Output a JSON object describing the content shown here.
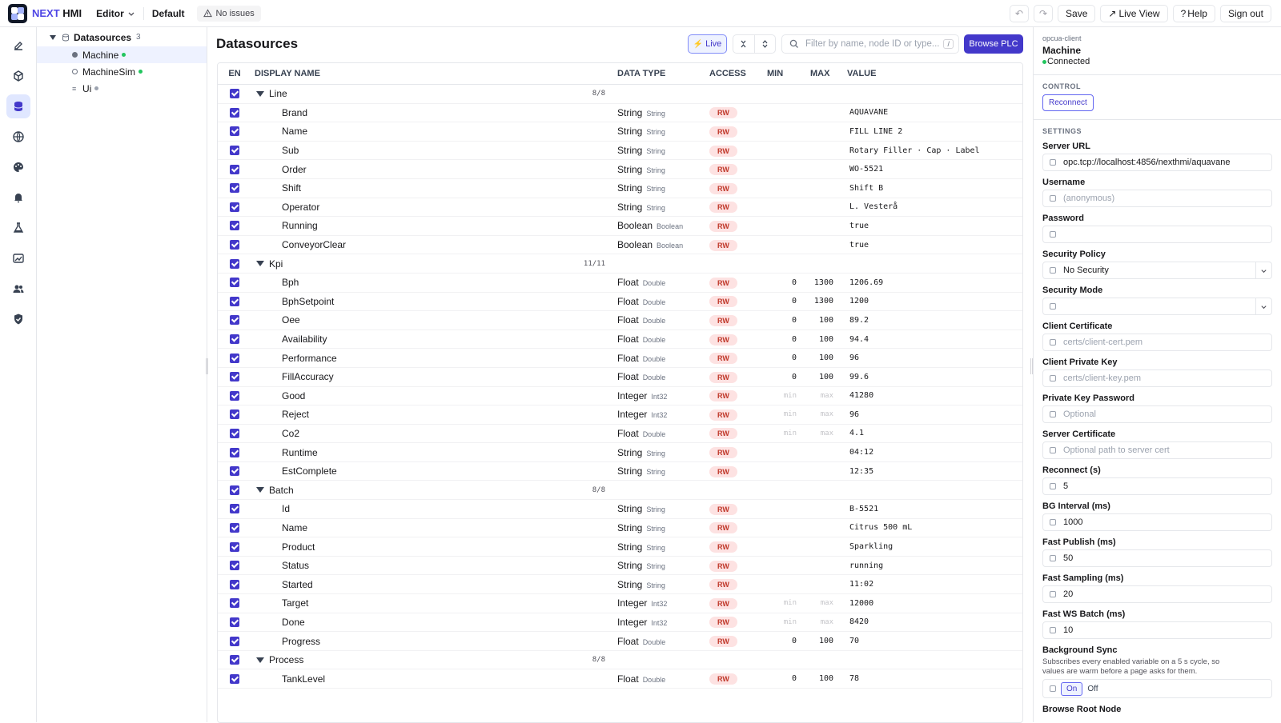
{
  "topbar": {
    "brand_a": "NEXT",
    "brand_b": "HMI",
    "mode": "Editor",
    "project": "Default",
    "issues": "No issues",
    "save": "Save",
    "live_view": "Live View",
    "help": "Help",
    "sign_out": "Sign out"
  },
  "tree": {
    "root": "Datasources",
    "count": "3",
    "items": [
      {
        "label": "Machine",
        "status": "#22c55e"
      },
      {
        "label": "MachineSim",
        "status": "#22c55e"
      },
      {
        "label": "Ui",
        "status": "#9ca3af"
      }
    ]
  },
  "main": {
    "title": "Datasources",
    "live": "Live",
    "filter_placeholder": "Filter by name, node ID or type...",
    "shortcut": "/",
    "browse": "Browse PLC",
    "columns": {
      "en": "EN",
      "name": "DISPLAY NAME",
      "type": "DATA TYPE",
      "access": "ACCESS",
      "min": "MIN",
      "max": "MAX",
      "value": "VALUE"
    },
    "rows": [
      {
        "kind": "group",
        "name": "Line",
        "count": "8/8"
      },
      {
        "name": "Brand",
        "type": "String",
        "sub": "String",
        "access": "RW",
        "min": "",
        "max": "",
        "value": "AQUAVANE"
      },
      {
        "name": "Name",
        "type": "String",
        "sub": "String",
        "access": "RW",
        "min": "",
        "max": "",
        "value": "FILL LINE 2"
      },
      {
        "name": "Sub",
        "type": "String",
        "sub": "String",
        "access": "RW",
        "min": "",
        "max": "",
        "value": "Rotary Filler · Cap · Label"
      },
      {
        "name": "Order",
        "type": "String",
        "sub": "String",
        "access": "RW",
        "min": "",
        "max": "",
        "value": "WO-5521"
      },
      {
        "name": "Shift",
        "type": "String",
        "sub": "String",
        "access": "RW",
        "min": "",
        "max": "",
        "value": "Shift B"
      },
      {
        "name": "Operator",
        "type": "String",
        "sub": "String",
        "access": "RW",
        "min": "",
        "max": "",
        "value": "L. Vesterå"
      },
      {
        "name": "Running",
        "type": "Boolean",
        "sub": "Boolean",
        "access": "RW",
        "min": "",
        "max": "",
        "value": "true"
      },
      {
        "name": "ConveyorClear",
        "type": "Boolean",
        "sub": "Boolean",
        "access": "RW",
        "min": "",
        "max": "",
        "value": "true"
      },
      {
        "kind": "group",
        "name": "Kpi",
        "count": "11/11"
      },
      {
        "name": "Bph",
        "type": "Float",
        "sub": "Double",
        "access": "RW",
        "min": "0",
        "max": "1300",
        "value": "1206.69"
      },
      {
        "name": "BphSetpoint",
        "type": "Float",
        "sub": "Double",
        "access": "RW",
        "min": "0",
        "max": "1300",
        "value": "1200"
      },
      {
        "name": "Oee",
        "type": "Float",
        "sub": "Double",
        "access": "RW",
        "min": "0",
        "max": "100",
        "value": "89.2"
      },
      {
        "name": "Availability",
        "type": "Float",
        "sub": "Double",
        "access": "RW",
        "min": "0",
        "max": "100",
        "value": "94.4"
      },
      {
        "name": "Performance",
        "type": "Float",
        "sub": "Double",
        "access": "RW",
        "min": "0",
        "max": "100",
        "value": "96"
      },
      {
        "name": "FillAccuracy",
        "type": "Float",
        "sub": "Double",
        "access": "RW",
        "min": "0",
        "max": "100",
        "value": "99.6"
      },
      {
        "name": "Good",
        "type": "Integer",
        "sub": "Int32",
        "access": "RW",
        "min": "min",
        "max": "max",
        "ph": true,
        "value": "41280"
      },
      {
        "name": "Reject",
        "type": "Integer",
        "sub": "Int32",
        "access": "RW",
        "min": "min",
        "max": "max",
        "ph": true,
        "value": "96"
      },
      {
        "name": "Co2",
        "type": "Float",
        "sub": "Double",
        "access": "RW",
        "min": "min",
        "max": "max",
        "ph": true,
        "value": "4.1"
      },
      {
        "name": "Runtime",
        "type": "String",
        "sub": "String",
        "access": "RW",
        "min": "",
        "max": "",
        "value": "04:12"
      },
      {
        "name": "EstComplete",
        "type": "String",
        "sub": "String",
        "access": "RW",
        "min": "",
        "max": "",
        "value": "12:35"
      },
      {
        "kind": "group",
        "name": "Batch",
        "count": "8/8"
      },
      {
        "name": "Id",
        "type": "String",
        "sub": "String",
        "access": "RW",
        "min": "",
        "max": "",
        "value": "B-5521"
      },
      {
        "name": "Name",
        "type": "String",
        "sub": "String",
        "access": "RW",
        "min": "",
        "max": "",
        "value": "Citrus 500 mL"
      },
      {
        "name": "Product",
        "type": "String",
        "sub": "String",
        "access": "RW",
        "min": "",
        "max": "",
        "value": "Sparkling"
      },
      {
        "name": "Status",
        "type": "String",
        "sub": "String",
        "access": "RW",
        "min": "",
        "max": "",
        "value": "running"
      },
      {
        "name": "Started",
        "type": "String",
        "sub": "String",
        "access": "RW",
        "min": "",
        "max": "",
        "value": "11:02"
      },
      {
        "name": "Target",
        "type": "Integer",
        "sub": "Int32",
        "access": "RW",
        "min": "min",
        "max": "max",
        "ph": true,
        "value": "12000"
      },
      {
        "name": "Done",
        "type": "Integer",
        "sub": "Int32",
        "access": "RW",
        "min": "min",
        "max": "max",
        "ph": true,
        "value": "8420"
      },
      {
        "name": "Progress",
        "type": "Float",
        "sub": "Double",
        "access": "RW",
        "min": "0",
        "max": "100",
        "value": "70"
      },
      {
        "kind": "group",
        "name": "Process",
        "count": "8/8"
      },
      {
        "name": "TankLevel",
        "type": "Float",
        "sub": "Double",
        "access": "RW",
        "min": "0",
        "max": "100",
        "value": "78"
      }
    ]
  },
  "panel": {
    "kicker": "opcua-client",
    "name": "Machine",
    "status": "Connected",
    "control": "CONTROL",
    "reconnect": "Reconnect",
    "settings": "SETTINGS",
    "fields": [
      {
        "label": "Server URL",
        "value": "opc.tcp://localhost:4856/nexthmi/aquavane",
        "placeholder": ""
      },
      {
        "label": "Username",
        "value": "",
        "placeholder": "(anonymous)"
      },
      {
        "label": "Password",
        "value": "",
        "placeholder": ""
      },
      {
        "label": "Security Policy",
        "value": "No Security",
        "placeholder": "",
        "select": true
      },
      {
        "label": "Security Mode",
        "value": "",
        "placeholder": "",
        "select": true
      },
      {
        "label": "Client Certificate",
        "value": "",
        "placeholder": "certs/client-cert.pem"
      },
      {
        "label": "Client Private Key",
        "value": "",
        "placeholder": "certs/client-key.pem"
      },
      {
        "label": "Private Key Password",
        "value": "",
        "placeholder": "Optional"
      },
      {
        "label": "Server Certificate",
        "value": "",
        "placeholder": "Optional path to server cert"
      },
      {
        "label": "Reconnect (s)",
        "value": "5",
        "placeholder": ""
      },
      {
        "label": "BG Interval (ms)",
        "value": "1000",
        "placeholder": ""
      },
      {
        "label": "Fast Publish (ms)",
        "value": "50",
        "placeholder": ""
      },
      {
        "label": "Fast Sampling (ms)",
        "value": "20",
        "placeholder": ""
      },
      {
        "label": "Fast WS Batch (ms)",
        "value": "10",
        "placeholder": ""
      }
    ],
    "bg_sync": {
      "label": "Background Sync",
      "desc": "Subscribes every enabled variable on a 5 s cycle, so values are warm before a page asks for them.",
      "on": "On",
      "off": "Off"
    },
    "browse_root": "Browse Root Node"
  },
  "colors": {
    "accent": "#4338ca",
    "rw_bg": "#fde2e2",
    "rw_fg": "#c0392b",
    "connected": "#22c55e"
  }
}
